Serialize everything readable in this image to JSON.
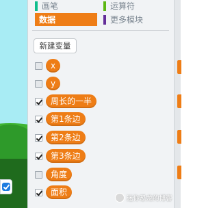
{
  "categories": {
    "pen": {
      "label": "画笔",
      "color": "#0fbd8c"
    },
    "operators": {
      "label": "运算符",
      "color": "#5cb712"
    },
    "data": {
      "label": "数据",
      "color": "#ee7d16"
    },
    "more": {
      "label": "更多模块",
      "color": "#632d99"
    }
  },
  "new_variable_label": "新建变量",
  "variables": [
    {
      "name": "x",
      "checked": false
    },
    {
      "name": "y",
      "checked": false
    },
    {
      "name": "周长的一半",
      "checked": true
    },
    {
      "name": "第1条边",
      "checked": true
    },
    {
      "name": "第2条边",
      "checked": true
    },
    {
      "name": "第3条边",
      "checked": true
    },
    {
      "name": "角度",
      "checked": false
    },
    {
      "name": "面积",
      "checked": true
    }
  ],
  "watermark": "迷你恐龙的博客",
  "colors": {
    "data_accent": "#ee7d16",
    "stage_sky": "#a8ecf4",
    "grass": "#2e9a2a"
  }
}
